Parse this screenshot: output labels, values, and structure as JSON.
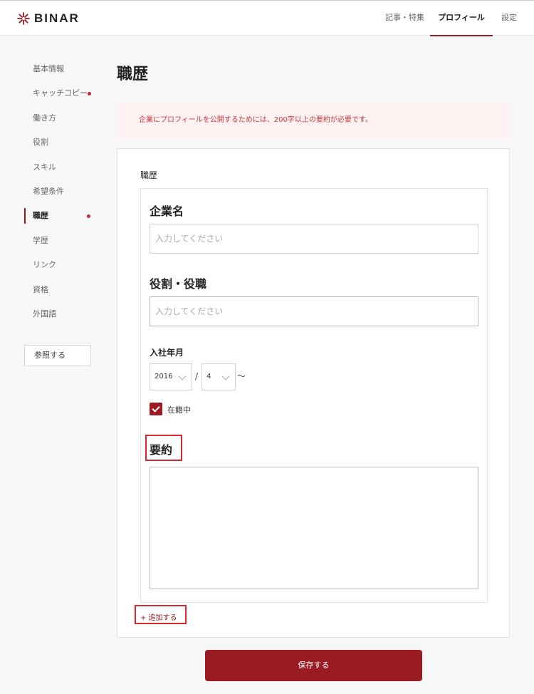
{
  "header": {
    "logo_text": "BINAR",
    "nav": [
      {
        "label": "記事・特集"
      },
      {
        "label": "プロフィール"
      },
      {
        "label": "設定"
      }
    ]
  },
  "sidebar": {
    "items": [
      {
        "label": "基本情報"
      },
      {
        "label": "キャッチコピー"
      },
      {
        "label": "働き方"
      },
      {
        "label": "役割"
      },
      {
        "label": "スキル"
      },
      {
        "label": "希望条件"
      },
      {
        "label": "職歴"
      },
      {
        "label": "学歴"
      },
      {
        "label": "リンク"
      },
      {
        "label": "資格"
      },
      {
        "label": "外国語"
      }
    ],
    "reference_button": "参照する"
  },
  "page": {
    "title": "職歴",
    "notice": "企業にプロフィールを公開するためには、200字以上の要約が必要です。"
  },
  "card": {
    "title": "職歴",
    "company_label": "企業名",
    "company_placeholder": "入力してください",
    "company_value": "",
    "role_label": "役割・役職",
    "role_placeholder": "入力してください",
    "role_value": "",
    "join_label": "入社年月",
    "year_value": "2016",
    "month_value": "4",
    "date_separator": "/",
    "range_mark": "〜",
    "current_label": "在籍中",
    "current_checked": true,
    "summary_label": "要約",
    "summary_value": "",
    "add_link": "+ 追加する"
  },
  "save_button": "保存する",
  "colors": {
    "brand": "#9b1b22",
    "notice_bg": "#fdf1f1",
    "notice_text": "#c73a40",
    "highlight": "#d8262e"
  }
}
